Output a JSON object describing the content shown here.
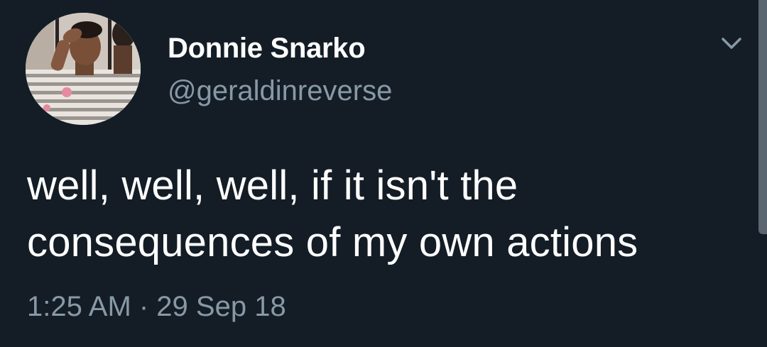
{
  "user": {
    "display_name": "Donnie Snarko",
    "handle": "@geraldinreverse"
  },
  "tweet": {
    "text_lines": [
      "well, well, well, if it isn't the",
      "consequences of my own actions"
    ],
    "timestamp": "1:25 AM · 29 Sep 18"
  },
  "icons": {
    "menu": "chevron-down-icon",
    "avatar": "profile-photo"
  },
  "colors": {
    "background": "#141d26",
    "primary_text": "#ffffff",
    "secondary_text": "#8899a6"
  }
}
